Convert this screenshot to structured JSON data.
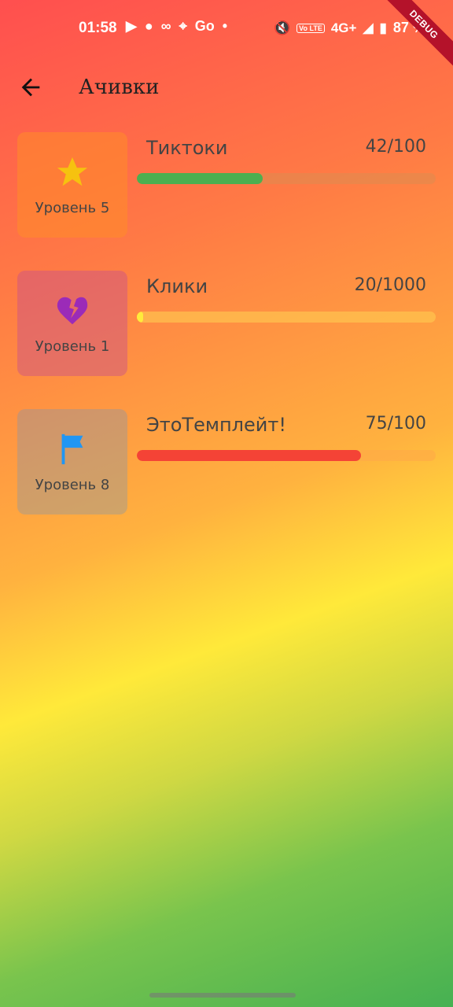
{
  "status_bar": {
    "time": "01:58",
    "icons_left": [
      "youtube-icon",
      "app-icon",
      "link-icon",
      "location-icon",
      "go-icon",
      "dot-icon"
    ],
    "network": "4G+",
    "volte": "Vo LTE",
    "battery_percent": "87 %"
  },
  "debug_banner": "DEBUG",
  "app_bar": {
    "title": "Ачивки"
  },
  "achievements": [
    {
      "name": "Тиктоки",
      "count": "42/100",
      "level": "Уровень 5",
      "icon": "star-icon",
      "icon_color": "#f6c20f",
      "progress": 0.42,
      "bar_color": "#4caf50"
    },
    {
      "name": "Клики",
      "count": "20/1000",
      "level": "Уровень 1",
      "icon": "broken-heart-icon",
      "icon_color": "#9b2bb8",
      "progress": 0.02,
      "bar_color": "#ffeb3b"
    },
    {
      "name": "ЭтоТемплейт!",
      "count": "75/100",
      "level": "Уровень 8",
      "icon": "flag-icon",
      "icon_color": "#2196f3",
      "progress": 0.75,
      "bar_color": "#f44336"
    }
  ]
}
